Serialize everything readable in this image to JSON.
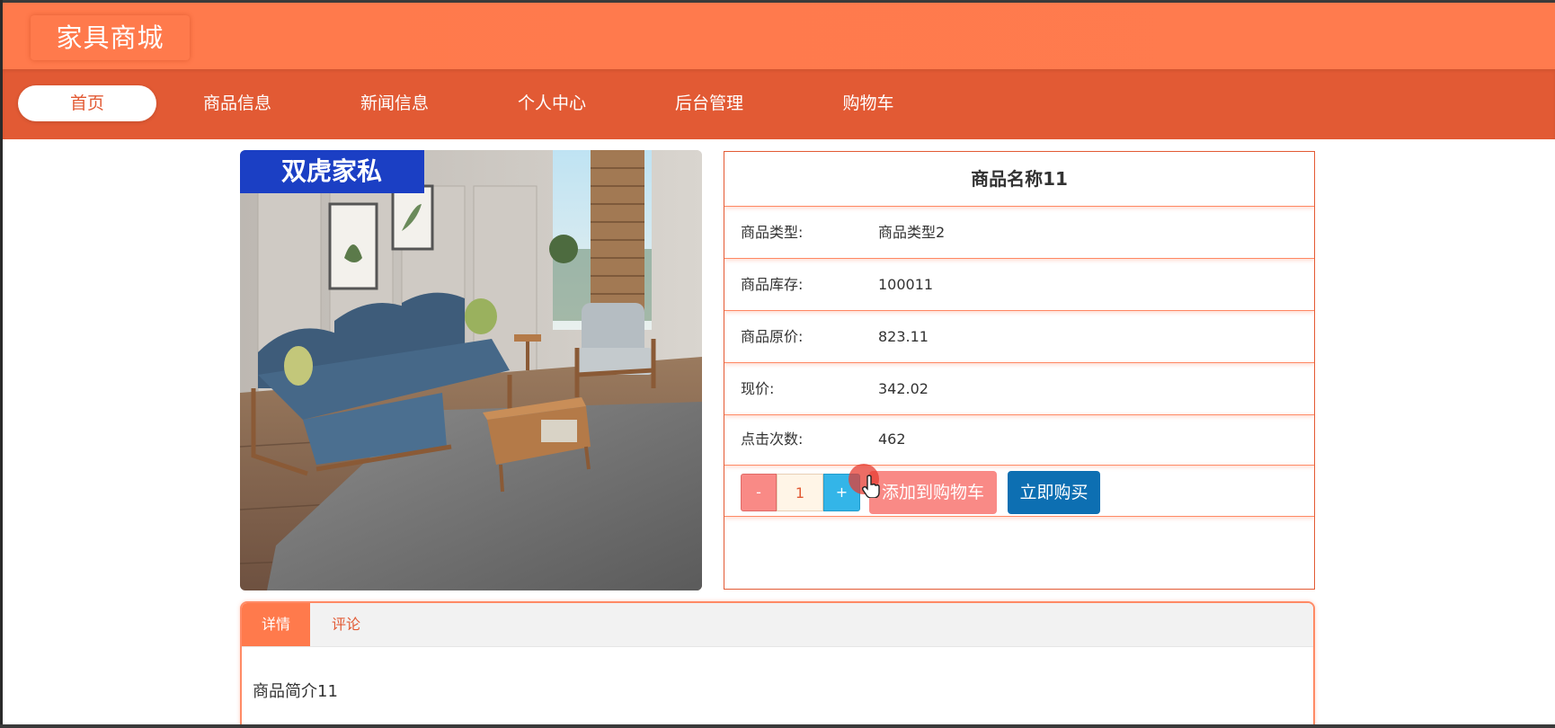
{
  "app": {
    "logo_text": "家具商城"
  },
  "nav": {
    "items": [
      {
        "label": "首页",
        "active": true
      },
      {
        "label": "商品信息",
        "active": false
      },
      {
        "label": "新闻信息",
        "active": false
      },
      {
        "label": "个人中心",
        "active": false
      },
      {
        "label": "后台管理",
        "active": false
      },
      {
        "label": "购物车",
        "active": false
      }
    ]
  },
  "product": {
    "image_brand_text": "双虎家私",
    "name": "商品名称11",
    "rows": [
      {
        "label": "商品类型:",
        "value": "商品类型2"
      },
      {
        "label": "商品库存:",
        "value": "100011"
      },
      {
        "label": "商品原价:",
        "value": "823.11"
      },
      {
        "label": "现价:",
        "value": "342.02"
      },
      {
        "label": "点击次数:",
        "value": "462"
      }
    ],
    "quantity": {
      "minus_label": "-",
      "value": "1",
      "plus_label": "+"
    },
    "add_to_cart_label": "添加到购物车",
    "buy_now_label": "立即购买"
  },
  "tabs": {
    "items": [
      {
        "label": "详情",
        "active": true
      },
      {
        "label": "评论",
        "active": false
      }
    ],
    "content": "商品简介11"
  },
  "colors": {
    "header": "#ff7a4c",
    "nav": "#e25a34",
    "accent_border": "#ff8a65",
    "add_to_cart": "#f98a86",
    "buy_now": "#0d6fb2",
    "plus_button": "#33b5e8"
  },
  "icons": {
    "cursor": "hand-pointer-icon"
  }
}
